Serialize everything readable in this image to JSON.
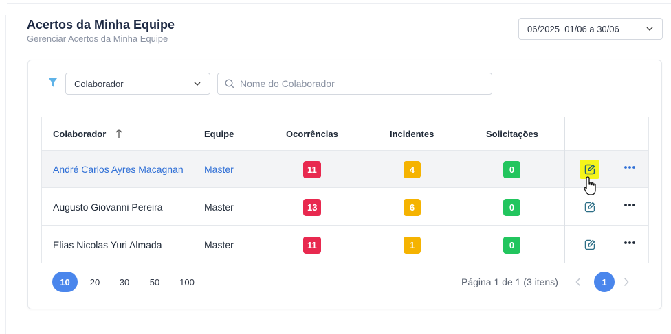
{
  "header": {
    "title": "Acertos da Minha Equipe",
    "subtitle": "Gerenciar Acertos da Minha Equipe"
  },
  "period": {
    "value": "06/2025  01/06 a 30/06"
  },
  "filters": {
    "field_select": "Colaborador",
    "search_placeholder": "Nome do Colaborador",
    "search_value": ""
  },
  "table": {
    "columns": [
      "Colaborador",
      "Equipe",
      "Ocorrências",
      "Incidentes",
      "Solicitações"
    ],
    "rows": [
      {
        "colaborador": "André Carlos Ayres Macagnan",
        "equipe": "Master",
        "ocorrencias": "11",
        "incidentes": "4",
        "solicitacoes": "0"
      },
      {
        "colaborador": "Augusto Giovanni Pereira",
        "equipe": "Master",
        "ocorrencias": "13",
        "incidentes": "6",
        "solicitacoes": "0"
      },
      {
        "colaborador": "Elias Nicolas Yuri Almada",
        "equipe": "Master",
        "ocorrencias": "11",
        "incidentes": "1",
        "solicitacoes": "0"
      }
    ]
  },
  "pagination": {
    "sizes": [
      "10",
      "20",
      "30",
      "50",
      "100"
    ],
    "info": "Página 1 de 1 (3 itens)",
    "current": "1"
  },
  "colors": {
    "accent": "#4a86ec",
    "link": "#2f6fd6",
    "badge_red": "#e8294f",
    "badge_yellow": "#f5b301",
    "badge_green": "#22c55e",
    "highlight": "#f5f51a"
  },
  "icons": [
    "chevron-down-icon",
    "filter-icon",
    "search-icon",
    "sort-up-icon",
    "edit-icon",
    "more-icon",
    "hand-cursor-icon",
    "chevron-left-icon",
    "chevron-right-icon"
  ]
}
